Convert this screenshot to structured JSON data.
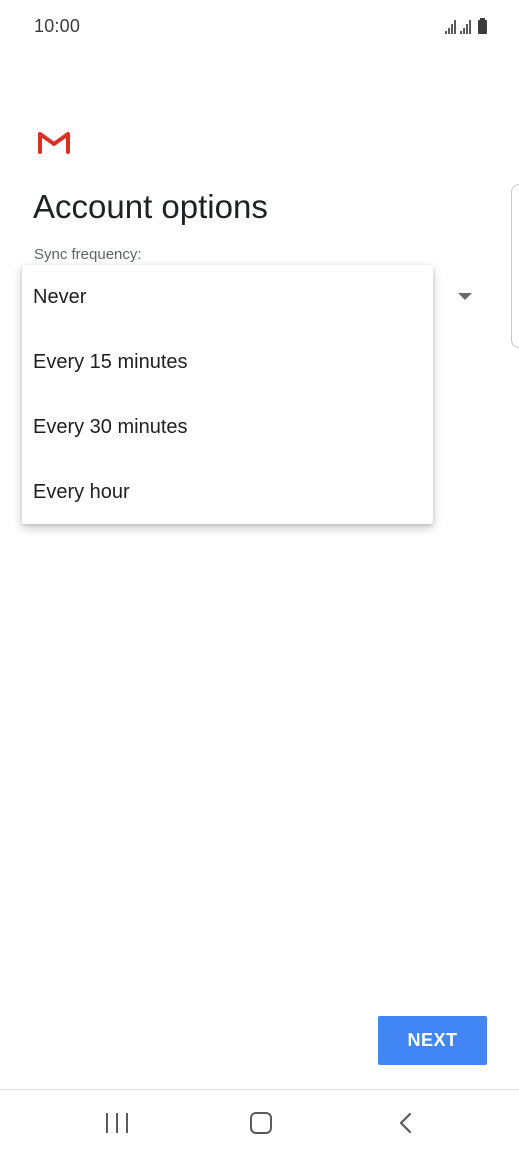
{
  "status_bar": {
    "time": "10:00",
    "icons": [
      "signal-icon",
      "signal-icon",
      "battery-icon"
    ]
  },
  "header": {
    "logo_icon": "gmail-logo-icon",
    "title": "Account options"
  },
  "sync": {
    "label": "Sync frequency:",
    "options": [
      {
        "label": "Never"
      },
      {
        "label": "Every 15 minutes"
      },
      {
        "label": "Every 30 minutes"
      },
      {
        "label": "Every hour"
      }
    ]
  },
  "actions": {
    "next_label": "NEXT"
  },
  "nav_bar": {
    "icons": [
      "recent-apps-icon",
      "home-icon",
      "back-icon"
    ]
  },
  "colors": {
    "accent": "#4285f4",
    "gmail_red": "#d93025"
  }
}
